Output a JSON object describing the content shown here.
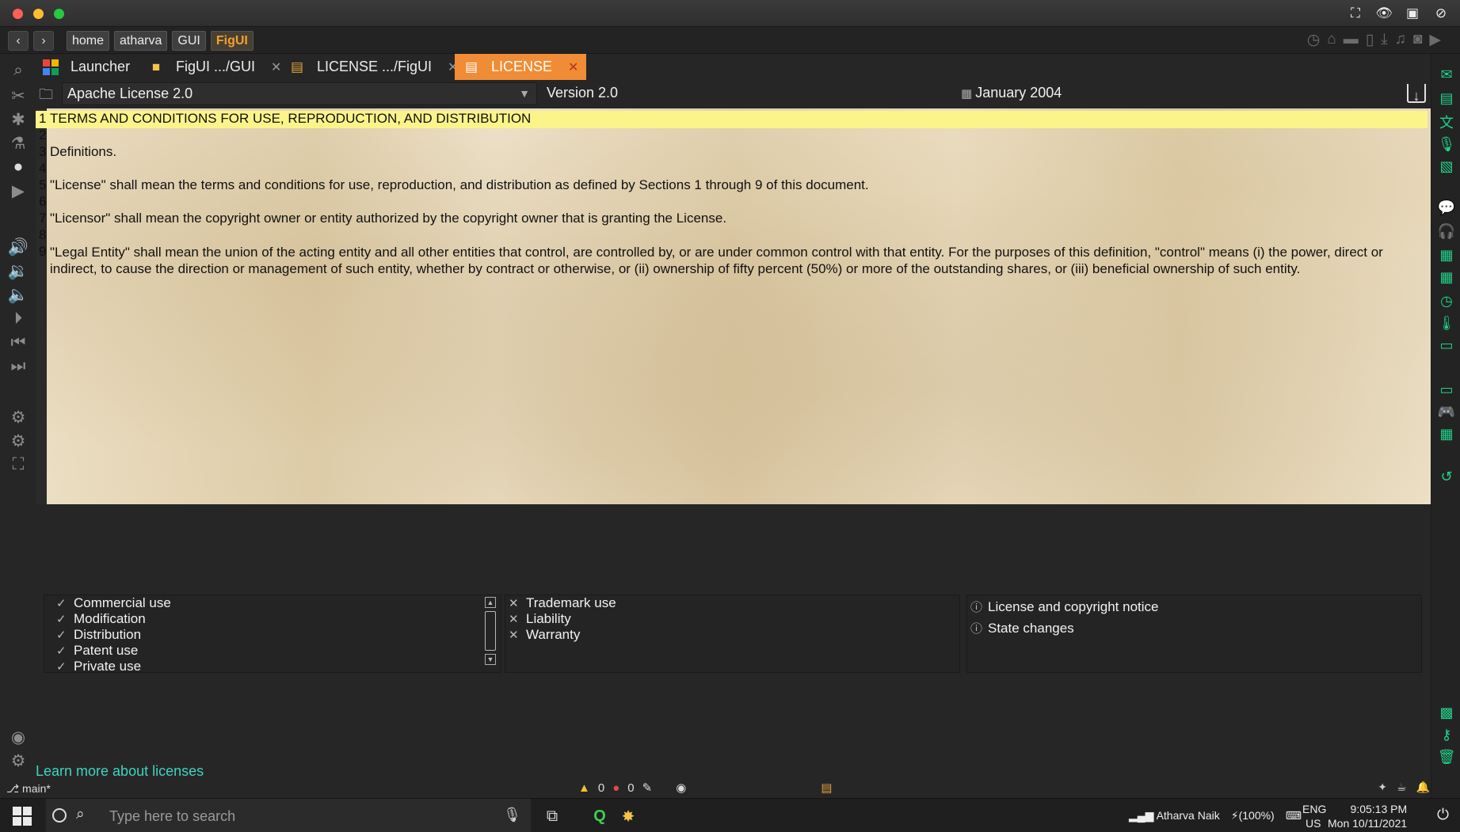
{
  "breadcrumbs": [
    "home",
    "atharva",
    "GUI",
    "FigUI"
  ],
  "tabs": [
    {
      "label": "Launcher",
      "closable": false
    },
    {
      "label": "FigUI .../GUI",
      "closable": true
    },
    {
      "label": "LICENSE .../FigUI",
      "closable": true
    },
    {
      "label": "LICENSE",
      "closable": true,
      "active": true
    }
  ],
  "doc_toolbar": {
    "license_selected": "Apache License 2.0",
    "version": "Version 2.0",
    "date": "January 2004"
  },
  "editor_lines": [
    {
      "n": "1",
      "text": "TERMS AND CONDITIONS FOR USE, REPRODUCTION, AND DISTRIBUTION"
    },
    {
      "n": "2",
      "text": ""
    },
    {
      "n": "3",
      "text": "Definitions."
    },
    {
      "n": "4",
      "text": ""
    },
    {
      "n": "5",
      "text": "\"License\" shall mean the terms and conditions for use, reproduction, and distribution as defined by Sections 1 through 9 of this document."
    },
    {
      "n": "6",
      "text": ""
    },
    {
      "n": "7",
      "text": "\"Licensor\" shall mean the copyright owner or entity authorized by the copyright owner that is granting the License."
    },
    {
      "n": "8",
      "text": ""
    },
    {
      "n": "9",
      "text": "\"Legal Entity\" shall mean the union of the acting entity and all other entities that control, are controlled by, or are under common control with that entity. For the purposes of this definition, \"control\" means (i) the power, direct or indirect, to cause the direction or management of such entity, whether by contract or otherwise, or (ii) ownership of fifty percent (50%) or more of the outstanding shares, or (iii) beneficial ownership of such entity."
    }
  ],
  "permissions": [
    "Commercial use",
    "Modification",
    "Distribution",
    "Patent use",
    "Private use"
  ],
  "limitations": [
    "Trademark use",
    "Liability",
    "Warranty"
  ],
  "conditions": [
    "License and copyright notice",
    "State changes"
  ],
  "learn_more": "Learn more about licenses",
  "status": {
    "branch": "main*",
    "warnings": "0",
    "errors": "0"
  },
  "taskbar": {
    "search_placeholder": "Type here to search",
    "user": "Atharva Naik",
    "battery": "(100%)",
    "lang_top": "ENG",
    "lang_bottom": "US",
    "time": "9:05:13 PM",
    "date": "Mon 10/11/2021"
  },
  "colors": {
    "accent_tab": "#f08c35",
    "active_crumb": "#f3a02e",
    "link": "#3fd3c0",
    "right_icons": "#1fd28a",
    "line_highlight": "#fbf48a"
  }
}
